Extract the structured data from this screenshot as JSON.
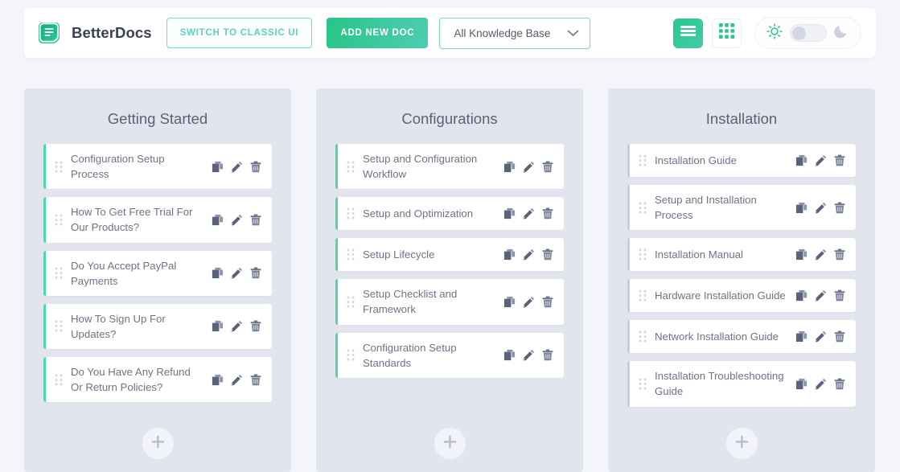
{
  "header": {
    "logo_icon": "betterdocs-logo-icon",
    "brand_name": "BetterDocs",
    "switch_classic_label": "SWITCH TO CLASSIC UI",
    "add_new_doc_label": "ADD NEW DOC",
    "knowledge_base_select": {
      "value": "All Knowledge Base",
      "chevron_icon": "chevron-down-icon"
    },
    "list_view_icon": "hamburger-list-view-icon",
    "grid_view_icon": "grid-view-icon",
    "theme": {
      "light_icon": "sun-icon",
      "dark_icon": "moon-icon",
      "toggle_state": "light"
    }
  },
  "colors": {
    "accent_green": "#3ec9a0",
    "accent_green_light": "#4bd9ac",
    "outline_teal": "#6fdcc4",
    "page_bg": "#f4f5fa",
    "column_bg": "#e2e5ee",
    "card_bg": "#ffffff",
    "title_text": "#5c6275",
    "body_text": "#6d7488",
    "neutral_border": "#c9cddb"
  },
  "card_action_icons": {
    "duplicate": "duplicate-icon",
    "edit": "pencil-edit-icon",
    "delete": "trash-delete-icon",
    "drag": "drag-handle-icon"
  },
  "add_card_label": "+",
  "columns": [
    {
      "title": "Getting Started",
      "accent": "green",
      "cards": [
        {
          "title": "Configuration Setup Process"
        },
        {
          "title": "How To Get Free Trial For Our Products?"
        },
        {
          "title": "Do You Accept PayPal Payments"
        },
        {
          "title": "How To Sign Up For Updates?"
        },
        {
          "title": "Do You Have Any Refund Or Return Policies?"
        }
      ]
    },
    {
      "title": "Configurations",
      "accent": "green",
      "cards": [
        {
          "title": "Setup and Configuration Workflow"
        },
        {
          "title": "Setup and Optimization"
        },
        {
          "title": "Setup Lifecycle"
        },
        {
          "title": "Setup Checklist and Framework"
        },
        {
          "title": "Configuration Setup Standards"
        }
      ]
    },
    {
      "title": "Installation",
      "accent": "neutral",
      "cards": [
        {
          "title": "Installation Guide"
        },
        {
          "title": "Setup and Installation Process"
        },
        {
          "title": "Installation Manual"
        },
        {
          "title": "Hardware Installation Guide"
        },
        {
          "title": "Network Installation Guide"
        },
        {
          "title": "Installation Troubleshooting Guide"
        }
      ]
    }
  ]
}
